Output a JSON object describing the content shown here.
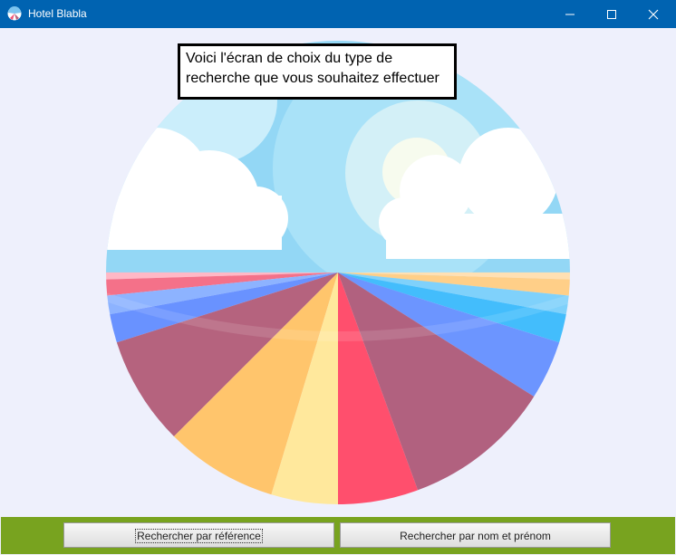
{
  "window": {
    "title": "Hotel Blabla",
    "icon": "globe-umbrella-icon",
    "controls": [
      "minimize-icon",
      "maximize-icon",
      "close-icon"
    ]
  },
  "main": {
    "instruction": "Voici l'écran de choix du type de recherche que vous souhaitez effectuer",
    "illustration": "beach-umbrella-illustration"
  },
  "actions": {
    "search_by_reference": "Rechercher par référence",
    "search_by_name": "Rechercher par nom et prénom"
  },
  "colors": {
    "titlebar": "#0063b1",
    "background": "#eef0fc",
    "bottom_bar": "#78a31f"
  }
}
